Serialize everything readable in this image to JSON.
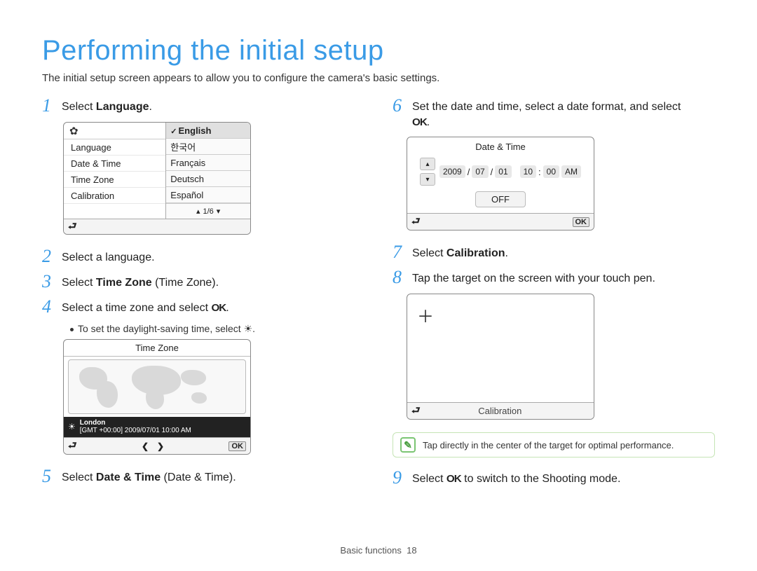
{
  "title": "Performing the initial setup",
  "subtitle": "The initial setup screen appears to allow you to configure the camera's basic settings.",
  "steps": {
    "s1": {
      "num": "1",
      "pre": "Select ",
      "bold": "Language",
      "post": "."
    },
    "s2": {
      "num": "2",
      "text": "Select a language."
    },
    "s3": {
      "num": "3",
      "pre": "Select ",
      "bold": "Time Zone",
      "post": " (Time Zone)."
    },
    "s4": {
      "num": "4",
      "pre": "Select a time zone and select ",
      "ok": "OK",
      "post": "."
    },
    "s4_bullet": "To set the daylight-saving time, select ",
    "s5": {
      "num": "5",
      "pre": "Select ",
      "bold": "Date & Time",
      "post": " (Date & Time)."
    },
    "s6": {
      "num": "6",
      "pre": "Set the date and time, select a date format, and select ",
      "ok": "OK",
      "post": "."
    },
    "s7": {
      "num": "7",
      "pre": "Select ",
      "bold": "Calibration",
      "post": "."
    },
    "s8": {
      "num": "8",
      "text": "Tap the target on the screen with your touch pen."
    },
    "s9": {
      "num": "9",
      "pre": "Select ",
      "ok": "OK",
      "post": " to switch to the Shooting mode."
    }
  },
  "lang_screen": {
    "menu": [
      "Language",
      "Date & Time",
      "Time Zone",
      "Calibration"
    ],
    "options": [
      "English",
      "한국어",
      "Français",
      "Deutsch",
      "Español"
    ],
    "page_indicator": "1/6"
  },
  "tz_screen": {
    "title": "Time Zone",
    "city": "London",
    "gmt_line": "[GMT +00:00] 2009/07/01 10:00 AM",
    "ok": "OK"
  },
  "dt_screen": {
    "title": "Date & Time",
    "year": "2009",
    "month": "07",
    "day": "01",
    "hour": "10",
    "minute": "00",
    "ampm": "AM",
    "sep": "/",
    "colon": ":",
    "off": "OFF",
    "ok": "OK"
  },
  "cal_screen": {
    "label": "Calibration"
  },
  "note": "Tap directly in the center of the target for optimal performance.",
  "footer_section": "Basic functions",
  "footer_page": "18"
}
